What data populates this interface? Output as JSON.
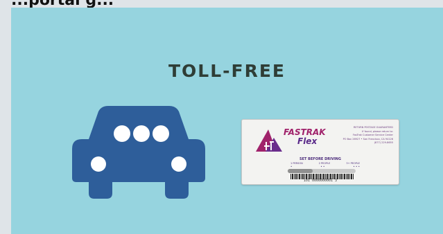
{
  "page": {
    "title_partial": "...portal g...",
    "colors": {
      "slide_background": "#96d4df",
      "heading": "#2f3d36",
      "car": "#2e5e9a",
      "brand_magenta": "#a0226b",
      "brand_purple": "#5a2a8a"
    }
  },
  "slide": {
    "heading": "TOLL-FREE",
    "car_icon": "car-icon",
    "tag": {
      "brand": "FASTRAK",
      "brand_sub": "Flex",
      "return_lines": [
        "RETURN POSTAGE GUARANTEED",
        "If found, please return to:",
        "FasTrak Customer Service Center",
        "PO Box 26927 • San Francisco, CA 94126",
        "(877) 229-8655"
      ],
      "instruction": "SET BEFORE DRIVING",
      "occupancy_labels": [
        "1 PERSON",
        "2 PEOPLE",
        "3+ PEOPLE"
      ],
      "occupancy_dots": [
        "•",
        "• •",
        "• • •"
      ],
      "serial": "101 0000000001 3"
    }
  }
}
